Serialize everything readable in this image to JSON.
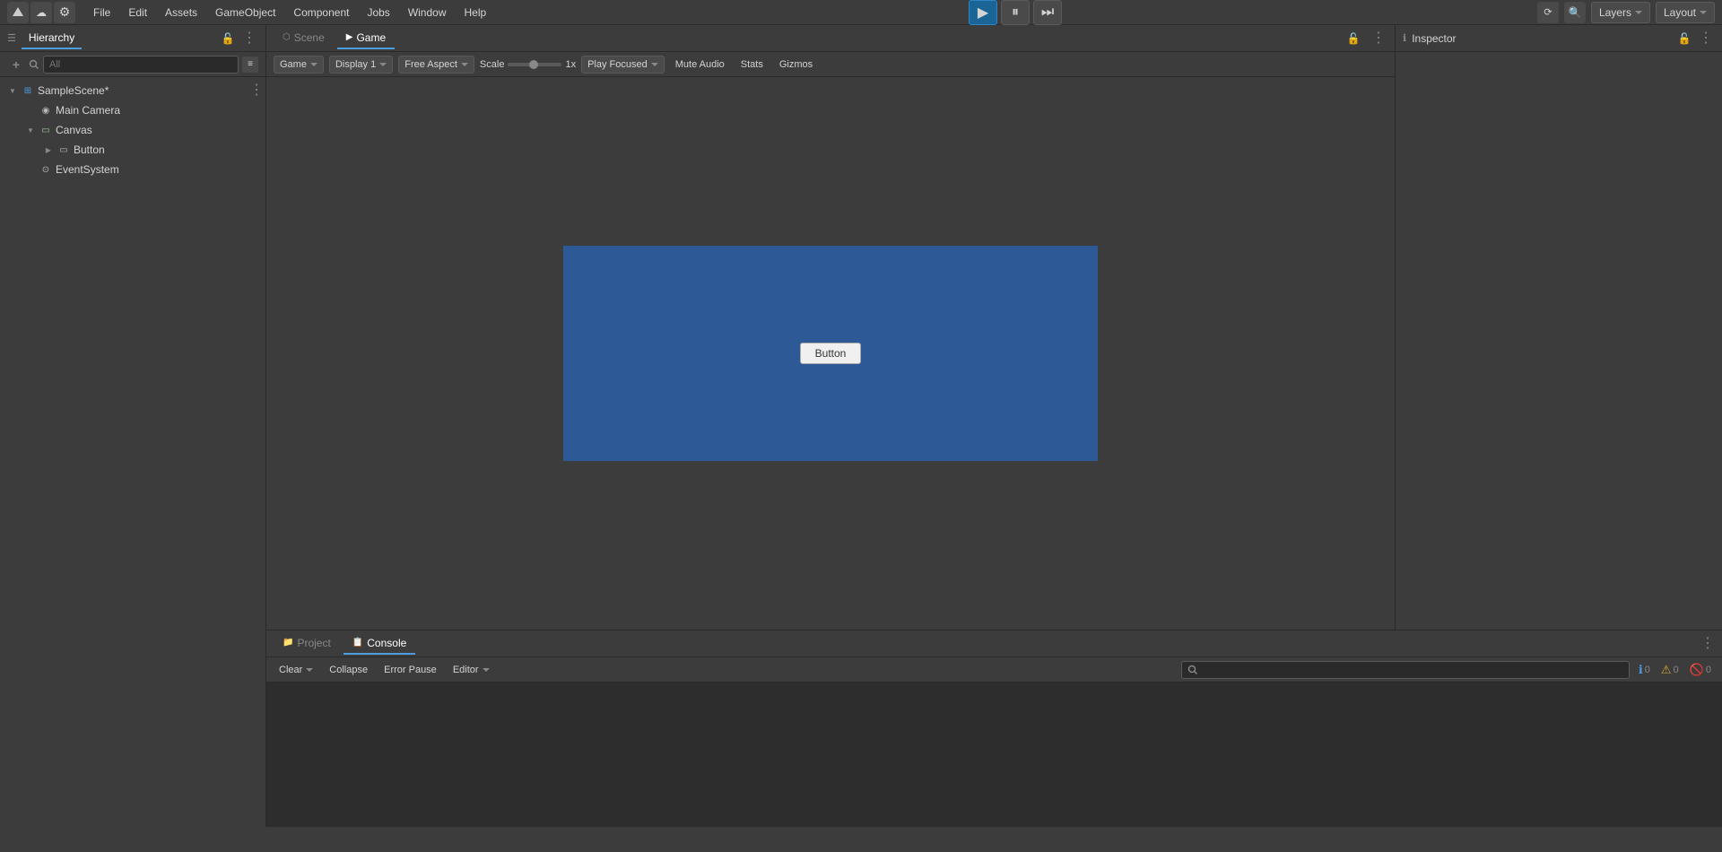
{
  "menubar": {
    "items": [
      "File",
      "Edit",
      "Assets",
      "GameObject",
      "Component",
      "Jobs",
      "Window",
      "Help"
    ]
  },
  "toolbar": {
    "layers_label": "Layers",
    "layout_label": "Layout"
  },
  "hierarchy": {
    "panel_title": "Hierarchy",
    "search_placeholder": "All",
    "items": [
      {
        "name": "SampleScene*",
        "depth": 0,
        "type": "scene",
        "has_arrow": true,
        "arrow_open": true
      },
      {
        "name": "Main Camera",
        "depth": 1,
        "type": "gameobject",
        "has_arrow": false
      },
      {
        "name": "Canvas",
        "depth": 1,
        "type": "canvas",
        "has_arrow": true,
        "arrow_open": true
      },
      {
        "name": "Button",
        "depth": 2,
        "type": "gameobject",
        "has_arrow": true,
        "arrow_open": false
      },
      {
        "name": "EventSystem",
        "depth": 1,
        "type": "gameobject",
        "has_arrow": false
      }
    ]
  },
  "scene_view": {
    "tab_label": "Scene",
    "game_tab_label": "Game"
  },
  "game_toolbar": {
    "game_label": "Game",
    "display_label": "Display 1",
    "aspect_label": "Free Aspect",
    "scale_label": "Scale",
    "scale_value": "1x",
    "play_focused_label": "Play Focused",
    "mute_audio_label": "Mute Audio",
    "stats_label": "Stats",
    "gizmos_label": "Gizmos"
  },
  "game_canvas": {
    "button_label": "Button",
    "background_color": "#2d5a96"
  },
  "bottom_panel": {
    "project_tab": "Project",
    "console_tab": "Console",
    "clear_btn": "Clear",
    "collapse_btn": "Collapse",
    "error_pause_btn": "Error Pause",
    "editor_btn": "Editor",
    "search_placeholder": "",
    "info_count": "0",
    "warn_count": "0",
    "error_count": "0"
  },
  "inspector": {
    "panel_title": "Inspector"
  }
}
